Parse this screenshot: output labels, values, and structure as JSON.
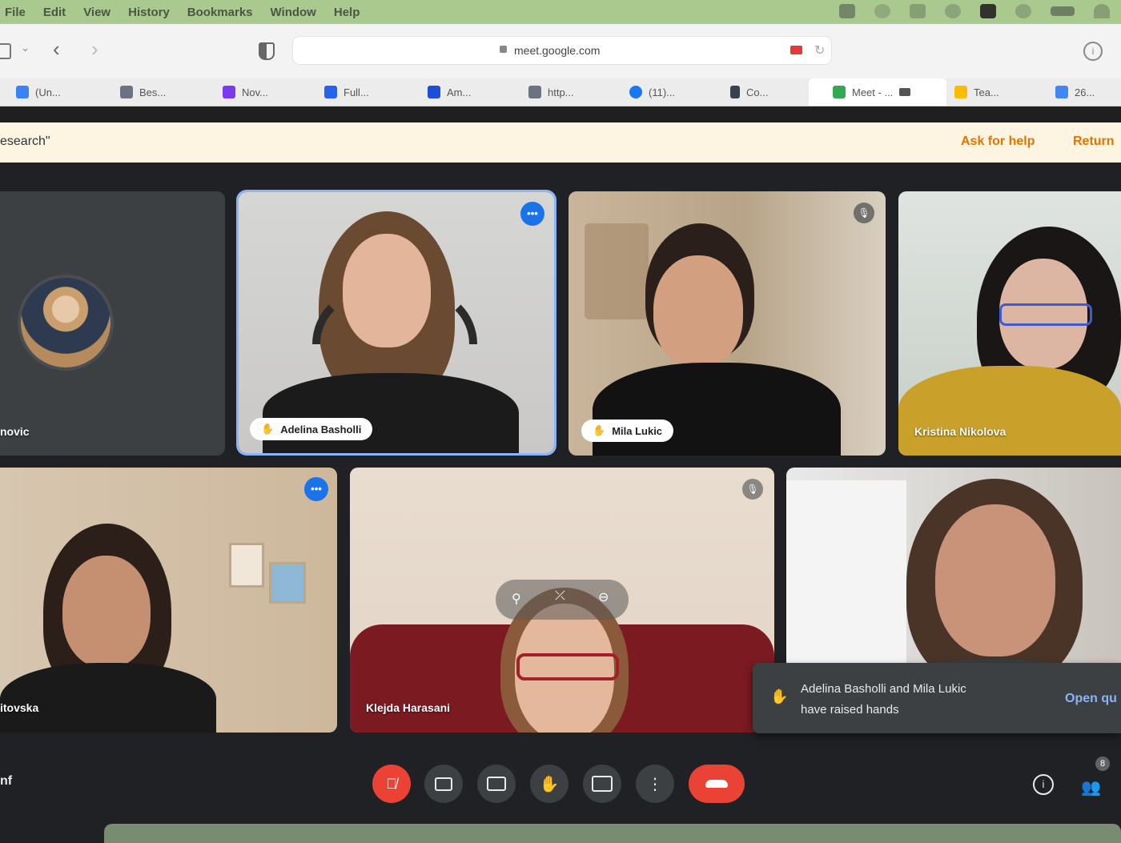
{
  "os_menu": {
    "items": [
      "File",
      "Edit",
      "View",
      "History",
      "Bookmarks",
      "Window",
      "Help"
    ]
  },
  "browser": {
    "url": "meet.google.com",
    "tabs": [
      {
        "label": "(Un...",
        "color": "#3b82f6"
      },
      {
        "label": "Bes...",
        "color": "#6b7280"
      },
      {
        "label": "Nov...",
        "color": "#7c3aed"
      },
      {
        "label": "Full...",
        "color": "#2563eb"
      },
      {
        "label": "Am...",
        "color": "#1d4ed8"
      },
      {
        "label": "http...",
        "color": "#6b7280"
      },
      {
        "label": "(11)...",
        "color": "#1877f2"
      },
      {
        "label": "Co...",
        "color": "#374151"
      },
      {
        "label": "Meet - ...",
        "color": "#34a853"
      },
      {
        "label": "Tea...",
        "color": "#fbbc04"
      },
      {
        "label": "26...",
        "color": "#4285f4"
      }
    ]
  },
  "banner": {
    "text": "esearch\"",
    "ask_help": "Ask for help",
    "return": "Return"
  },
  "participants": [
    {
      "name": "novic"
    },
    {
      "name": "Adelina Basholli"
    },
    {
      "name": "Mila Lukic"
    },
    {
      "name": "Kristina Nikolova"
    },
    {
      "name": "itovska"
    },
    {
      "name": "Klejda Harasani"
    }
  ],
  "toast": {
    "message_line1": "Adelina Basholli and Mila Lukic",
    "message_line2": "have raised hands",
    "action": "Open qu"
  },
  "bottom_left": {
    "text": "nf"
  },
  "people_count": "8",
  "colors": {
    "end_call": "#ea4335",
    "accent": "#1a73e8",
    "warning_orange": "#e37400"
  }
}
